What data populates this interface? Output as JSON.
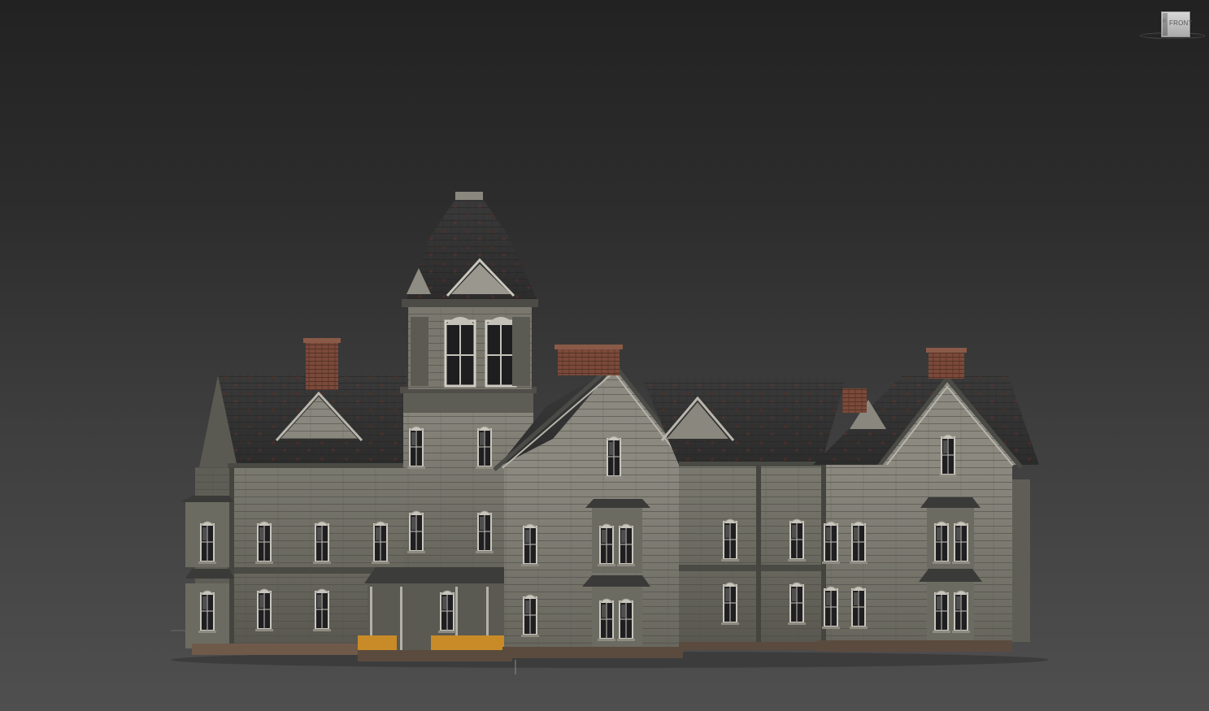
{
  "viewport": {
    "background_top": "#222222",
    "background_bottom": "#4f4f4f"
  },
  "viewcube": {
    "face_label": "FRONT",
    "side_label": "R"
  },
  "scene": {
    "subject": "victorian-mansion-model"
  }
}
